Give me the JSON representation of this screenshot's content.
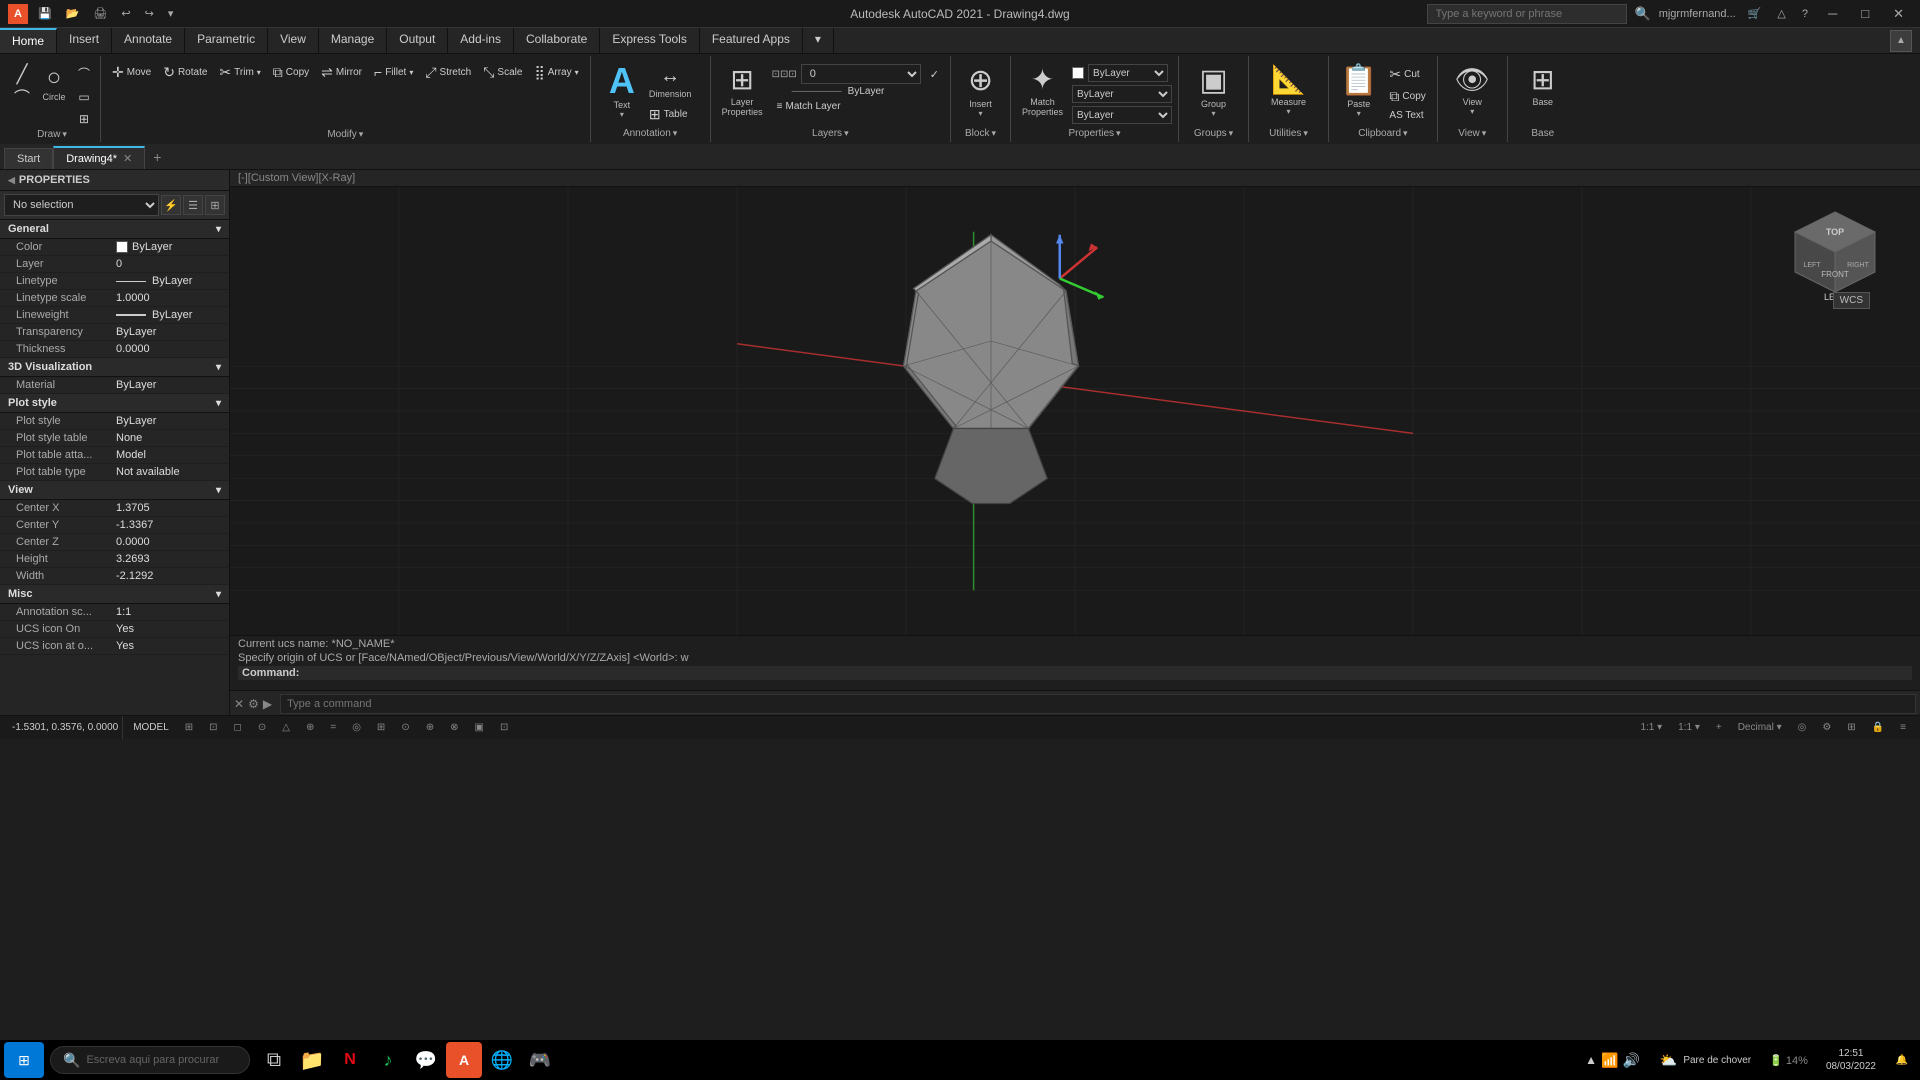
{
  "titlebar": {
    "logo": "A",
    "title": "Autodesk AutoCAD 2021 - Drawing4.dwg",
    "search_placeholder": "Type a keyword or phrase",
    "user": "mjgrmfernand...",
    "min": "─",
    "max": "□",
    "close": "✕"
  },
  "ribbon": {
    "tabs": [
      {
        "id": "home",
        "label": "Home",
        "active": true
      },
      {
        "id": "insert",
        "label": "Insert"
      },
      {
        "id": "annotate",
        "label": "Annotate"
      },
      {
        "id": "parametric",
        "label": "Parametric"
      },
      {
        "id": "view",
        "label": "View"
      },
      {
        "id": "manage",
        "label": "Manage"
      },
      {
        "id": "output",
        "label": "Output"
      },
      {
        "id": "addins",
        "label": "Add-ins"
      },
      {
        "id": "collaborate",
        "label": "Collaborate"
      },
      {
        "id": "express",
        "label": "Express Tools"
      },
      {
        "id": "featured",
        "label": "Featured Apps"
      },
      {
        "id": "more",
        "label": "▾"
      }
    ],
    "groups": {
      "draw": {
        "label": "Draw",
        "buttons": [
          {
            "id": "line",
            "icon": "╱",
            "label": "Line"
          },
          {
            "id": "polyline",
            "icon": "⌒",
            "label": "Polyline"
          },
          {
            "id": "circle",
            "icon": "○",
            "label": "Circle"
          },
          {
            "id": "arc",
            "icon": "⌒",
            "label": "Arc"
          }
        ]
      },
      "modify": {
        "label": "Modify",
        "buttons": [
          {
            "id": "move",
            "icon": "✛",
            "label": "Move"
          },
          {
            "id": "rotate",
            "icon": "↻",
            "label": "Rotate"
          },
          {
            "id": "trim",
            "icon": "✂",
            "label": "Trim"
          },
          {
            "id": "copy",
            "icon": "⧉",
            "label": "Copy"
          },
          {
            "id": "mirror",
            "icon": "⇌",
            "label": "Mirror"
          },
          {
            "id": "fillet",
            "icon": "⌐",
            "label": "Fillet"
          },
          {
            "id": "stretch",
            "icon": "⤢",
            "label": "Stretch"
          },
          {
            "id": "scale",
            "icon": "⤡",
            "label": "Scale"
          },
          {
            "id": "array",
            "icon": "⣿",
            "label": "Array"
          }
        ]
      },
      "annotation": {
        "label": "Annotation",
        "buttons": [
          {
            "id": "text",
            "icon": "A",
            "label": "Text"
          },
          {
            "id": "dimension",
            "icon": "↔",
            "label": "Dimension"
          },
          {
            "id": "table",
            "icon": "⊞",
            "label": "Table"
          }
        ]
      },
      "layers": {
        "label": "Layers",
        "layer_name": "0",
        "bylayer_color": "ByLayer",
        "bylayer_linetype": "ByLayer",
        "bylayer_lineweight": "ByLayer",
        "buttons": [
          {
            "id": "layer-props",
            "icon": "⊞",
            "label": "Layer Properties"
          },
          {
            "id": "make-current",
            "icon": "✓",
            "label": "Make Current"
          },
          {
            "id": "match-layer",
            "icon": "≡",
            "label": "Match Layer"
          }
        ]
      },
      "block": {
        "label": "Block",
        "buttons": [
          {
            "id": "insert",
            "icon": "⊕",
            "label": "Insert"
          }
        ]
      },
      "properties": {
        "label": "Properties",
        "buttons": [
          {
            "id": "match-props",
            "icon": "✦",
            "label": "Match Properties"
          }
        ],
        "color": "ByLayer",
        "linetype": "ByLayer",
        "lineweight": "ByLayer"
      },
      "groups": {
        "label": "Groups",
        "buttons": [
          {
            "id": "group",
            "icon": "▣",
            "label": "Group"
          }
        ]
      },
      "utilities": {
        "label": "Utilities",
        "buttons": [
          {
            "id": "measure",
            "icon": "📐",
            "label": "Measure"
          }
        ]
      },
      "clipboard": {
        "label": "Clipboard",
        "buttons": [
          {
            "id": "paste",
            "icon": "📋",
            "label": "Paste"
          },
          {
            "id": "cut",
            "icon": "✂",
            "label": "Cut"
          },
          {
            "id": "copy-clip",
            "icon": "⧉",
            "label": "Copy"
          }
        ]
      },
      "view_group": {
        "label": "View",
        "buttons": [
          {
            "id": "view",
            "icon": "👁",
            "label": "View"
          }
        ]
      },
      "base": {
        "label": "Base",
        "buttons": [
          {
            "id": "base",
            "icon": "⊞",
            "label": "Base"
          }
        ]
      }
    }
  },
  "doc_tabs": [
    {
      "id": "start",
      "label": "Start",
      "active": false,
      "closeable": false
    },
    {
      "id": "drawing4",
      "label": "Drawing4*",
      "active": true,
      "closeable": true
    }
  ],
  "properties_panel": {
    "title": "PROPERTIES",
    "selection": "No selection",
    "general": {
      "color": "ByLayer",
      "layer": "0",
      "linetype": "ByLayer",
      "linetype_scale": "1.0000",
      "lineweight": "ByLayer",
      "transparency": "ByLayer",
      "thickness": "0.0000"
    },
    "visualization_3d": {
      "material": "ByLayer"
    },
    "plot_style": {
      "plot_style": "ByLayer",
      "plot_style_table": "None",
      "plot_table_attached": "Model",
      "plot_table_type": "Not available"
    },
    "view": {
      "center_x": "1.3705",
      "center_y": "-1.3367",
      "center_z": "0.0000",
      "height": "3.2693",
      "width": "-2.1292"
    },
    "misc": {
      "annotation_scale": "1:1",
      "ucs_icon_on": "Yes",
      "ucs_icon_at": "Yes"
    }
  },
  "viewport": {
    "header": "[-][Custom View][X-Ray]"
  },
  "command": {
    "line1": "Current ucs name:  *NO_NAME*",
    "line2": "Specify origin of UCS or [Face/NAmed/OBject/Previous/View/World/X/Y/Z/ZAxis] <World>: w",
    "prompt": "Command:",
    "input_placeholder": "Type a command"
  },
  "statusbar": {
    "coords": "-1.5301, 0.3576, 0.0000",
    "model": "MODEL",
    "items": [
      "MODEL",
      "⊞⊞",
      "≡≡",
      "↗",
      "⊙",
      "⊡",
      "⟲",
      "⊕",
      "△",
      "⊗",
      "⊞",
      "⊙",
      "⊕",
      "⊗",
      "▣",
      "⊡",
      "1:1",
      "+",
      "Decimal",
      "≡"
    ]
  },
  "taskbar": {
    "search_placeholder": "Escreva aqui para procurar",
    "battery": "14%",
    "weather": "Pare de chover",
    "time": "12:51",
    "date": "08/03/2022",
    "apps": [
      "⊞",
      "🔍",
      "📋",
      "📁",
      "N",
      "♪",
      "💬",
      "🅰",
      "🌐",
      "🎮"
    ]
  }
}
